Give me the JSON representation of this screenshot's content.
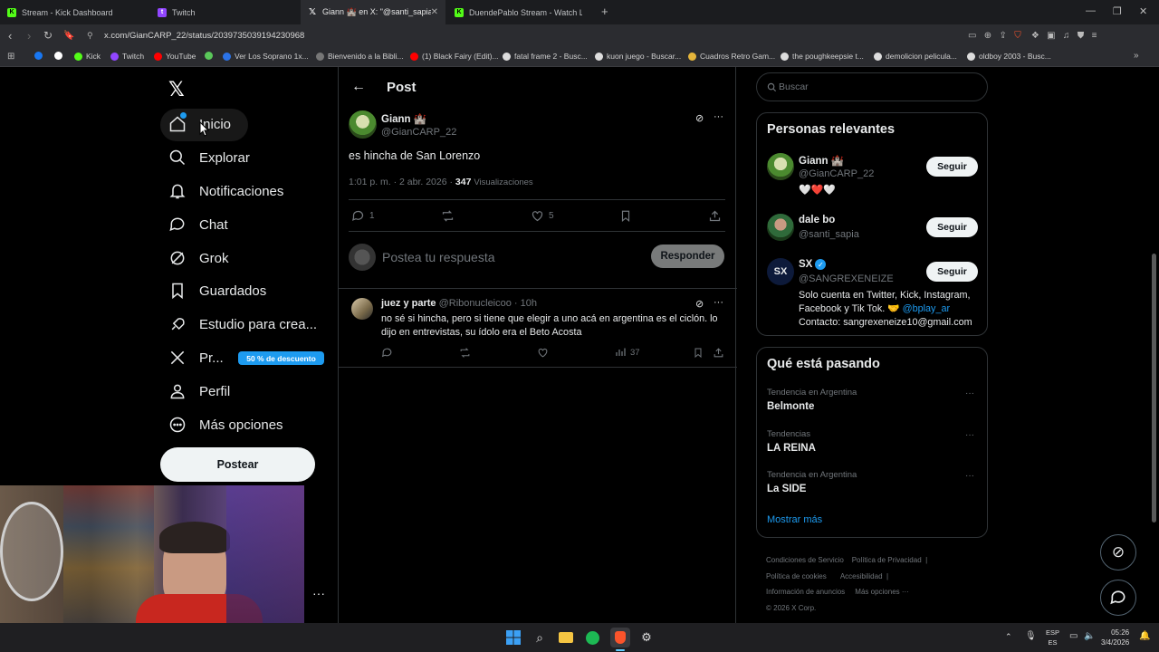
{
  "browser": {
    "tabs": [
      {
        "title": "Stream - Kick Dashboard",
        "color": "#53fc18",
        "glyph": "K"
      },
      {
        "title": "Twitch",
        "color": "#9146ff",
        "glyph": "t"
      },
      {
        "title": "Giann 🏰 en X: \"@santi_sapia @",
        "color": "#ffffff",
        "glyph": "X",
        "active": true
      },
      {
        "title": "DuendePablo Stream - Watch Liv",
        "color": "#53fc18",
        "glyph": "K"
      }
    ],
    "url": "x.com/GianCARP_22/status/2039735039194230968",
    "bookmarks": [
      {
        "label": "",
        "color": "#1877f2"
      },
      {
        "label": "",
        "color": "#ffffff"
      },
      {
        "label": "Kick",
        "color": "#53fc18"
      },
      {
        "label": "Twitch",
        "color": "#9146ff"
      },
      {
        "label": "YouTube",
        "color": "#ff0000"
      },
      {
        "label": "",
        "color": "#5ac85a"
      },
      {
        "label": "Ver Los Soprano 1x...",
        "color": "#2b73e8"
      },
      {
        "label": "Bienvenido a la Bibli...",
        "color": "#777777"
      },
      {
        "label": "(1) Black Fairy (Edit)...",
        "color": "#ff0000"
      },
      {
        "label": "fatal frame 2 - Busc...",
        "color": "#dddddd"
      },
      {
        "label": "kuon juego - Buscar...",
        "color": "#dddddd"
      },
      {
        "label": "Cuadros Retro Gam...",
        "color": "#e5b53b"
      },
      {
        "label": "the poughkeepsie t...",
        "color": "#dddddd"
      },
      {
        "label": "demolicion pelicula...",
        "color": "#dddddd"
      },
      {
        "label": "oldboy 2003 - Busc...",
        "color": "#dddddd"
      }
    ]
  },
  "sidebar": {
    "items": [
      {
        "label": "Inicio",
        "icon": "home-icon"
      },
      {
        "label": "Explorar",
        "icon": "search-icon"
      },
      {
        "label": "Notificaciones",
        "icon": "bell-icon"
      },
      {
        "label": "Chat",
        "icon": "chat-icon"
      },
      {
        "label": "Grok",
        "icon": "grok-icon"
      },
      {
        "label": "Guardados",
        "icon": "bookmark-icon"
      },
      {
        "label": "Estudio para crea...",
        "icon": "rocket-icon"
      },
      {
        "label": "Pr...",
        "icon": "x-premium-icon"
      },
      {
        "label": "Perfil",
        "icon": "person-icon"
      },
      {
        "label": "Más opciones",
        "icon": "more-circle-icon"
      }
    ],
    "premium_badge": "50 % de descuento",
    "post_button": "Postear"
  },
  "post": {
    "header": "Post",
    "author_name": "Giann 🏰",
    "author_handle": "@GianCARP_22",
    "text": "es hincha de San Lorenzo",
    "time": "1:01 p. m. · 2 abr. 2026 ·",
    "views_count": "347",
    "views_label": "Visualizaciones",
    "replies": "1",
    "likes": "5",
    "reply_placeholder": "Postea tu respuesta",
    "reply_button": "Responder"
  },
  "reply": {
    "author_name": "juez y parte",
    "author_handle": "@Ribonucleicoo · 10h",
    "text": "no sé si hincha, pero si tiene que elegir a uno acá en argentina es el ciclón. lo dijo en entrevistas, su ídolo era el Beto Acosta",
    "views": "37"
  },
  "right": {
    "search_placeholder": "Buscar",
    "relevant_title": "Personas relevantes",
    "people": [
      {
        "name": "Giann 🏰",
        "handle": "@GianCARP_22",
        "bio": "🤍❤️🤍",
        "follow": "Seguir"
      },
      {
        "name": "dale bo",
        "handle": "@santi_sapia",
        "follow": "Seguir"
      },
      {
        "name": "SX",
        "handle": "@SANGREXENEIZE",
        "bio_line1": "Solo cuenta en Twitter, Kick, Instagram,",
        "bio_line2a": "Facebook y Tik Tok. 🤝 ",
        "bio_link": "@bplay_ar",
        "bio_line3": "Contacto: sangrexeneize10@gmail.com",
        "follow": "Seguir"
      }
    ],
    "trends_title": "Qué está pasando",
    "trends": [
      {
        "context": "Tendencia en Argentina",
        "name": "Belmonte"
      },
      {
        "context": "Tendencias",
        "name": "LA REINA"
      },
      {
        "context": "Tendencia en Argentina",
        "name": "La SIDE"
      }
    ],
    "show_more": "Mostrar más",
    "footer": {
      "l1a": "Condiciones de Servicio",
      "l1b": "Política de Privacidad",
      "l2a": "Política de cookies",
      "l2b": "Accesibilidad",
      "l3a": "Información de anuncios",
      "l3b": "Más opciones ···",
      "l4": "© 2026 X Corp."
    }
  },
  "taskbar": {
    "lang1": "ESP",
    "lang2": "ES",
    "time": "05:26",
    "date": "3/4/2026"
  },
  "colors": {
    "accent": "#1d9bf0",
    "background": "#000000",
    "border": "#2f3336",
    "muted": "#71767b"
  }
}
